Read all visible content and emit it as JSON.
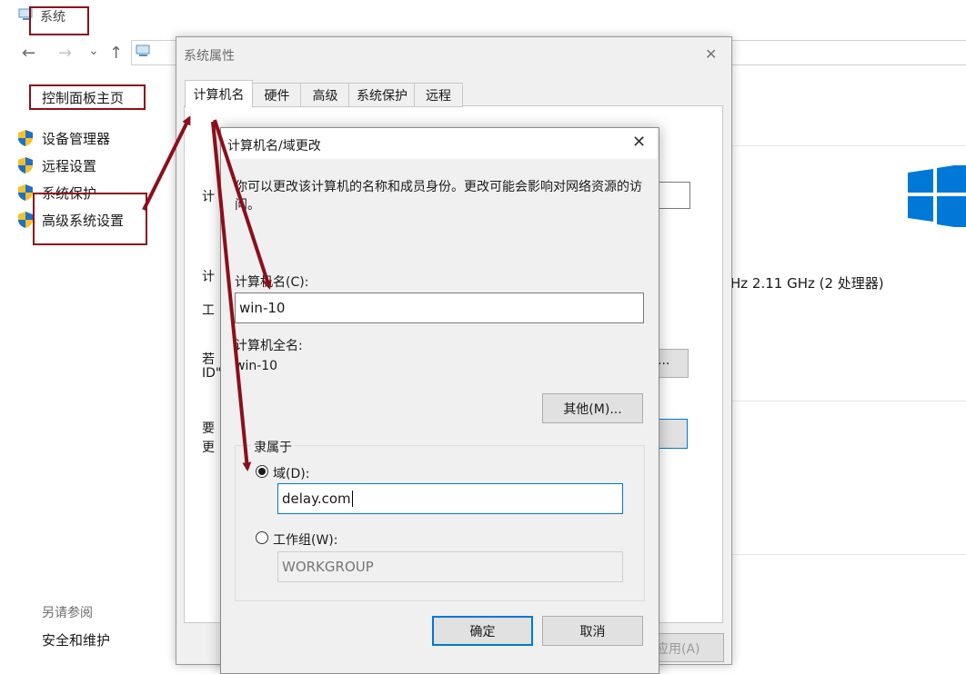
{
  "background_window": {
    "title": "系统",
    "nav": {
      "back": "←",
      "forward": "→",
      "dropdown": "⌄",
      "up": "↑"
    },
    "sidebar": {
      "home_link": "控制面板主页",
      "items": [
        {
          "label": "设备管理器",
          "icon": "shield-icon"
        },
        {
          "label": "远程设置",
          "icon": "shield-icon"
        },
        {
          "label": "系统保护",
          "icon": "shield-icon"
        },
        {
          "label": "高级系统设置",
          "icon": "shield-icon"
        }
      ],
      "see_also_heading": "另请参阅",
      "see_also_link": "安全和维护"
    },
    "processor_text": "Hz   2.11 GHz  (2 处理器)",
    "logo_color": "#0078d7"
  },
  "system_properties": {
    "title": "系统属性",
    "close": "✕",
    "tabs": [
      "计算机名",
      "硬件",
      "高级",
      "系统保护",
      "远程"
    ],
    "active_tab": 0,
    "partial_labels": [
      "计",
      "计",
      "工",
      "若",
      "ID\"",
      "要",
      "更"
    ],
    "apply_label_partial": "应用(A)",
    "ellipsis_btn": "..."
  },
  "computer_name_dialog": {
    "title": "计算机名/域更改",
    "close": "✕",
    "description": "你可以更改该计算机的名称和成员身份。更改可能会影响对网络资源的访问。",
    "computer_name_label": "计算机名(C):",
    "computer_name_value": "win-10",
    "full_name_label": "计算机全名:",
    "full_name_value": "win-10",
    "more_button": "其他(M)...",
    "member_of_label": "隶属于",
    "domain_option": {
      "label": "域(D):",
      "selected": true,
      "value": "delay.com"
    },
    "workgroup_option": {
      "label": "工作组(W):",
      "selected": false,
      "value": "WORKGROUP"
    },
    "ok_button": "确定",
    "cancel_button": "取消"
  },
  "colors": {
    "annotation": "#8b0f1a",
    "accent": "#0078d7"
  }
}
